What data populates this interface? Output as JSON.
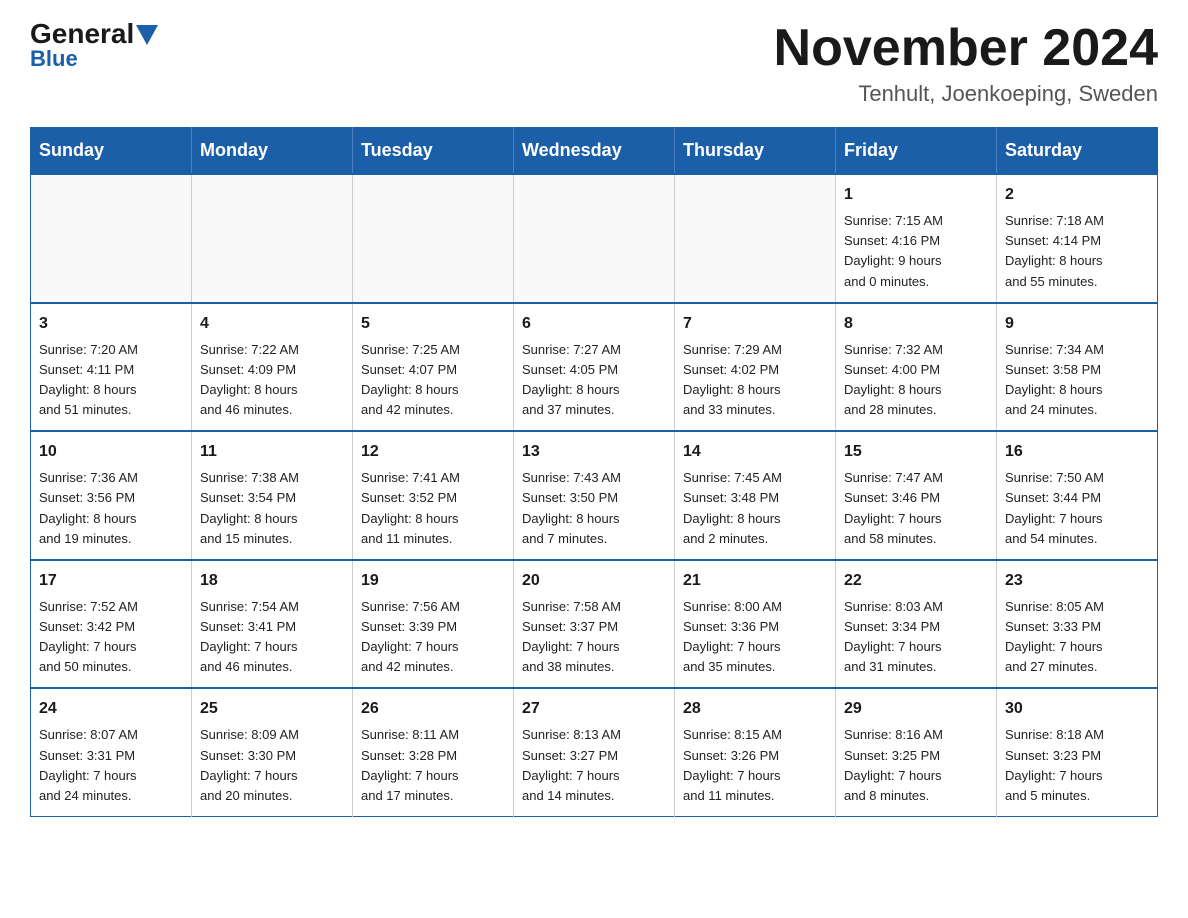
{
  "header": {
    "logo_general": "General",
    "logo_blue": "Blue",
    "month_title": "November 2024",
    "location": "Tenhult, Joenkoeping, Sweden"
  },
  "weekdays": [
    "Sunday",
    "Monday",
    "Tuesday",
    "Wednesday",
    "Thursday",
    "Friday",
    "Saturday"
  ],
  "weeks": [
    [
      {
        "day": "",
        "info": ""
      },
      {
        "day": "",
        "info": ""
      },
      {
        "day": "",
        "info": ""
      },
      {
        "day": "",
        "info": ""
      },
      {
        "day": "",
        "info": ""
      },
      {
        "day": "1",
        "info": "Sunrise: 7:15 AM\nSunset: 4:16 PM\nDaylight: 9 hours\nand 0 minutes."
      },
      {
        "day": "2",
        "info": "Sunrise: 7:18 AM\nSunset: 4:14 PM\nDaylight: 8 hours\nand 55 minutes."
      }
    ],
    [
      {
        "day": "3",
        "info": "Sunrise: 7:20 AM\nSunset: 4:11 PM\nDaylight: 8 hours\nand 51 minutes."
      },
      {
        "day": "4",
        "info": "Sunrise: 7:22 AM\nSunset: 4:09 PM\nDaylight: 8 hours\nand 46 minutes."
      },
      {
        "day": "5",
        "info": "Sunrise: 7:25 AM\nSunset: 4:07 PM\nDaylight: 8 hours\nand 42 minutes."
      },
      {
        "day": "6",
        "info": "Sunrise: 7:27 AM\nSunset: 4:05 PM\nDaylight: 8 hours\nand 37 minutes."
      },
      {
        "day": "7",
        "info": "Sunrise: 7:29 AM\nSunset: 4:02 PM\nDaylight: 8 hours\nand 33 minutes."
      },
      {
        "day": "8",
        "info": "Sunrise: 7:32 AM\nSunset: 4:00 PM\nDaylight: 8 hours\nand 28 minutes."
      },
      {
        "day": "9",
        "info": "Sunrise: 7:34 AM\nSunset: 3:58 PM\nDaylight: 8 hours\nand 24 minutes."
      }
    ],
    [
      {
        "day": "10",
        "info": "Sunrise: 7:36 AM\nSunset: 3:56 PM\nDaylight: 8 hours\nand 19 minutes."
      },
      {
        "day": "11",
        "info": "Sunrise: 7:38 AM\nSunset: 3:54 PM\nDaylight: 8 hours\nand 15 minutes."
      },
      {
        "day": "12",
        "info": "Sunrise: 7:41 AM\nSunset: 3:52 PM\nDaylight: 8 hours\nand 11 minutes."
      },
      {
        "day": "13",
        "info": "Sunrise: 7:43 AM\nSunset: 3:50 PM\nDaylight: 8 hours\nand 7 minutes."
      },
      {
        "day": "14",
        "info": "Sunrise: 7:45 AM\nSunset: 3:48 PM\nDaylight: 8 hours\nand 2 minutes."
      },
      {
        "day": "15",
        "info": "Sunrise: 7:47 AM\nSunset: 3:46 PM\nDaylight: 7 hours\nand 58 minutes."
      },
      {
        "day": "16",
        "info": "Sunrise: 7:50 AM\nSunset: 3:44 PM\nDaylight: 7 hours\nand 54 minutes."
      }
    ],
    [
      {
        "day": "17",
        "info": "Sunrise: 7:52 AM\nSunset: 3:42 PM\nDaylight: 7 hours\nand 50 minutes."
      },
      {
        "day": "18",
        "info": "Sunrise: 7:54 AM\nSunset: 3:41 PM\nDaylight: 7 hours\nand 46 minutes."
      },
      {
        "day": "19",
        "info": "Sunrise: 7:56 AM\nSunset: 3:39 PM\nDaylight: 7 hours\nand 42 minutes."
      },
      {
        "day": "20",
        "info": "Sunrise: 7:58 AM\nSunset: 3:37 PM\nDaylight: 7 hours\nand 38 minutes."
      },
      {
        "day": "21",
        "info": "Sunrise: 8:00 AM\nSunset: 3:36 PM\nDaylight: 7 hours\nand 35 minutes."
      },
      {
        "day": "22",
        "info": "Sunrise: 8:03 AM\nSunset: 3:34 PM\nDaylight: 7 hours\nand 31 minutes."
      },
      {
        "day": "23",
        "info": "Sunrise: 8:05 AM\nSunset: 3:33 PM\nDaylight: 7 hours\nand 27 minutes."
      }
    ],
    [
      {
        "day": "24",
        "info": "Sunrise: 8:07 AM\nSunset: 3:31 PM\nDaylight: 7 hours\nand 24 minutes."
      },
      {
        "day": "25",
        "info": "Sunrise: 8:09 AM\nSunset: 3:30 PM\nDaylight: 7 hours\nand 20 minutes."
      },
      {
        "day": "26",
        "info": "Sunrise: 8:11 AM\nSunset: 3:28 PM\nDaylight: 7 hours\nand 17 minutes."
      },
      {
        "day": "27",
        "info": "Sunrise: 8:13 AM\nSunset: 3:27 PM\nDaylight: 7 hours\nand 14 minutes."
      },
      {
        "day": "28",
        "info": "Sunrise: 8:15 AM\nSunset: 3:26 PM\nDaylight: 7 hours\nand 11 minutes."
      },
      {
        "day": "29",
        "info": "Sunrise: 8:16 AM\nSunset: 3:25 PM\nDaylight: 7 hours\nand 8 minutes."
      },
      {
        "day": "30",
        "info": "Sunrise: 8:18 AM\nSunset: 3:23 PM\nDaylight: 7 hours\nand 5 minutes."
      }
    ]
  ]
}
